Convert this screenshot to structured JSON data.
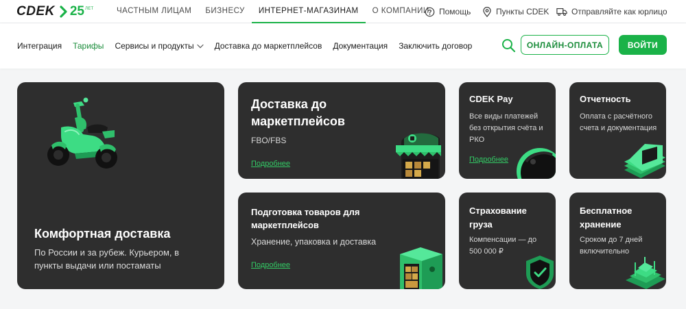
{
  "logo": {
    "brand": "CDEK",
    "anniversary": "25",
    "anniversary_suffix": "ЛЕТ"
  },
  "segments": [
    {
      "label": "ЧАСТНЫМ ЛИЦАМ"
    },
    {
      "label": "БИЗНЕСУ"
    },
    {
      "label": "ИНТЕРНЕТ-МАГАЗИНАМ"
    },
    {
      "label": "О КОМПАНИИ"
    }
  ],
  "utility": {
    "help": "Помощь",
    "points": "Пункты CDEK",
    "legal": "Отправляйте как юрлицо"
  },
  "nav": {
    "items": [
      {
        "label": "Интеграция"
      },
      {
        "label": "Тарифы"
      },
      {
        "label": "Сервисы и продукты"
      },
      {
        "label": "Доставка до маркетплейсов"
      },
      {
        "label": "Документация"
      },
      {
        "label": "Заключить договор"
      }
    ],
    "online_pay": "ОНЛАЙН-ОПЛАТА",
    "login": "ВОЙТИ"
  },
  "cards": {
    "comfort": {
      "title": "Комфортная доставка",
      "desc": "По России и за рубеж. Курьером, в пункты выдачи или постаматы"
    },
    "market": {
      "title": "Доставка до маркетплейсов",
      "desc": "FBO/FBS",
      "more": "Подробнее"
    },
    "prep": {
      "title": "Подготовка товаров для маркетплейсов",
      "desc": "Хранение, упаковка и доставка",
      "more": "Подробнее"
    },
    "pay": {
      "title": "CDEK Pay",
      "desc": "Все виды платежей без открытия счёта и РКО",
      "more": "Подробнее"
    },
    "report": {
      "title": "Отчетность",
      "desc": "Оплата с расчётного счета и документация"
    },
    "insure": {
      "title": "Страхование груза",
      "desc": "Компенсации — до 500 000 ₽"
    },
    "storage": {
      "title": "Бесплатное хранение",
      "desc": "Сроком до 7 дней включительно"
    }
  },
  "colors": {
    "accent": "#1ab248",
    "card_bg": "#2e2e2e",
    "page_bg": "#f4f5f6",
    "link": "#33cc66"
  }
}
